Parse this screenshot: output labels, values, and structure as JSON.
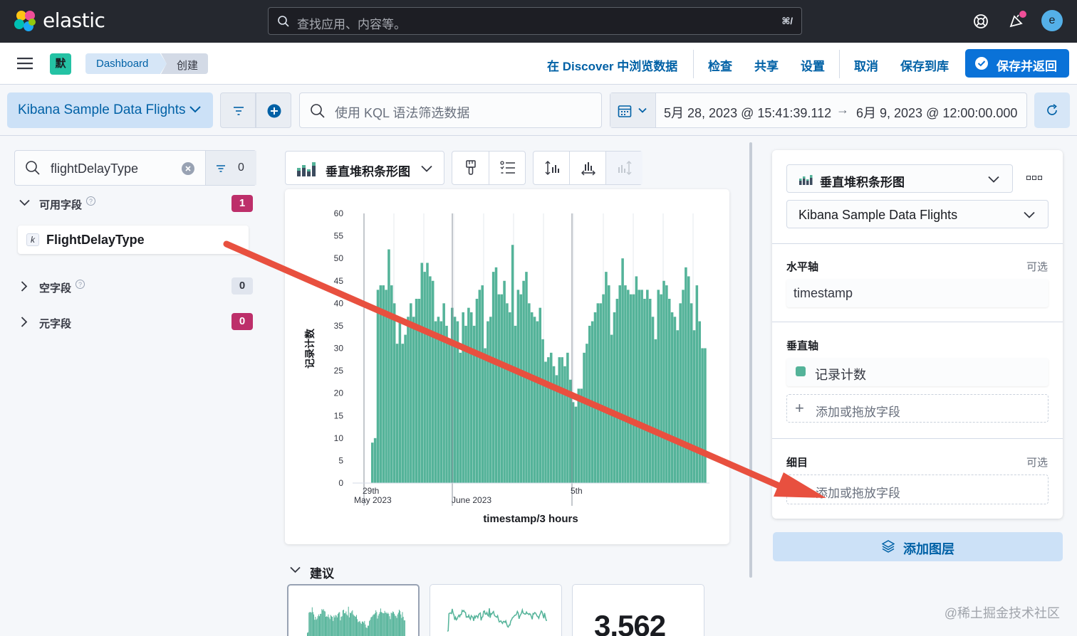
{
  "header": {
    "brand": "elastic",
    "search_placeholder": "查找应用、内容等。",
    "search_shortcut": "⌘/",
    "avatar_letter": "e"
  },
  "nav": {
    "space_badge": "默",
    "breadcrumbs": [
      "Dashboard",
      "创建"
    ],
    "links": [
      "在 Discover 中浏览数据",
      "检查",
      "共享",
      "设置",
      "取消",
      "保存到库"
    ],
    "save_return": "保存并返回"
  },
  "query": {
    "data_view": "Kibana Sample Data Flights",
    "kql_placeholder": "使用 KQL 语法筛选数据",
    "start_date": "5月 28, 2023 @ 15:41:39.112",
    "arrow": "→",
    "end_date": "6月 9, 2023 @ 12:00:00.000"
  },
  "field_list": {
    "search_value": "flightDelayType",
    "filter_count": "0",
    "available_label": "可用字段",
    "available_count": "1",
    "field_name": "FlightDelayType",
    "field_type_letter": "k",
    "empty_label": "空字段",
    "empty_count": "0",
    "meta_label": "元字段",
    "meta_count": "0"
  },
  "workspace": {
    "chart_type": "垂直堆积条形图",
    "suggestions_label": "建议",
    "suggestion_metric": "3,562"
  },
  "chart_data": {
    "type": "bar",
    "ylabel": "记录计数",
    "xlabel": "timestamp/3 hours",
    "ylim": [
      0,
      60
    ],
    "yticks": [
      0,
      5,
      10,
      15,
      20,
      25,
      30,
      35,
      40,
      45,
      50,
      55,
      60
    ],
    "xticks": [
      {
        "line1": "29th",
        "line2": "May 2023"
      },
      {
        "line1": "",
        "line2": "June 2023"
      },
      {
        "line1": "5th",
        "line2": ""
      }
    ],
    "color": "#54b399",
    "values": [
      9,
      10,
      43,
      44,
      44,
      43,
      52,
      44,
      40,
      31,
      36,
      31,
      33,
      37,
      40,
      37,
      41,
      41,
      49,
      47,
      49,
      46,
      45,
      36,
      37,
      36,
      40,
      35,
      32,
      39,
      37,
      36,
      29,
      38,
      35,
      39,
      38,
      35,
      41,
      43,
      44,
      30,
      36,
      37,
      47,
      48,
      42,
      42,
      45,
      40,
      38,
      53,
      35,
      43,
      42,
      45,
      47,
      40,
      38,
      37,
      36,
      39,
      32,
      27,
      28,
      29,
      26,
      24,
      28,
      28,
      26,
      29,
      23,
      18,
      17,
      21,
      21,
      29,
      31,
      35,
      36,
      38,
      40,
      40,
      42,
      47,
      44,
      33,
      38,
      41,
      44,
      50,
      44,
      43,
      42,
      42,
      46,
      43,
      43,
      41,
      43,
      41,
      37,
      32,
      43,
      42,
      45,
      44,
      41,
      38,
      37,
      34,
      40,
      43,
      48,
      46,
      40,
      34,
      44,
      36,
      30,
      30
    ]
  },
  "config": {
    "chart_type": "垂直堆积条形图",
    "data_view": "Kibana Sample Data Flights",
    "horizontal_label": "水平轴",
    "optional": "可选",
    "horizontal_value": "timestamp",
    "vertical_label": "垂直轴",
    "vertical_value": "记录计数",
    "add_field": "添加或拖放字段",
    "breakdown_label": "细目",
    "add_field_2": "添加或拖放字段",
    "add_layer": "添加图层"
  },
  "watermark": "@稀土掘金技术社区"
}
